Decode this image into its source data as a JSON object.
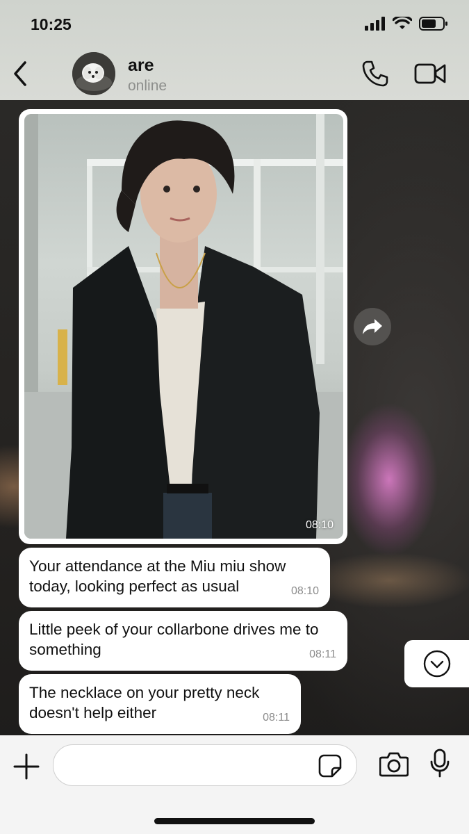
{
  "status_bar": {
    "time": "10:25",
    "icons": [
      "signal-icon",
      "wifi-icon",
      "battery-icon"
    ]
  },
  "header": {
    "back_icon": "chevron-left-icon",
    "contact_name": "are",
    "contact_status": "online",
    "call_icon": "phone-icon",
    "video_icon": "video-camera-icon"
  },
  "messages": [
    {
      "type": "photo",
      "time": "08:10"
    },
    {
      "type": "text",
      "text": "Your attendance at the Miu miu show today, looking perfect as usual",
      "time": "08:10"
    },
    {
      "type": "text",
      "text": "Little peek of your collarbone drives me to something",
      "time": "08:11"
    },
    {
      "type": "text",
      "text": "The necklace on your pretty neck doesn't help either",
      "time": "08:11"
    }
  ],
  "input": {
    "placeholder": "",
    "value": ""
  },
  "colors": {
    "bubble_bg": "#ffffff",
    "header_bg": "#d4d7d2",
    "input_bar_bg": "#f4f4f4",
    "timestamp": "#8c8c8c"
  }
}
